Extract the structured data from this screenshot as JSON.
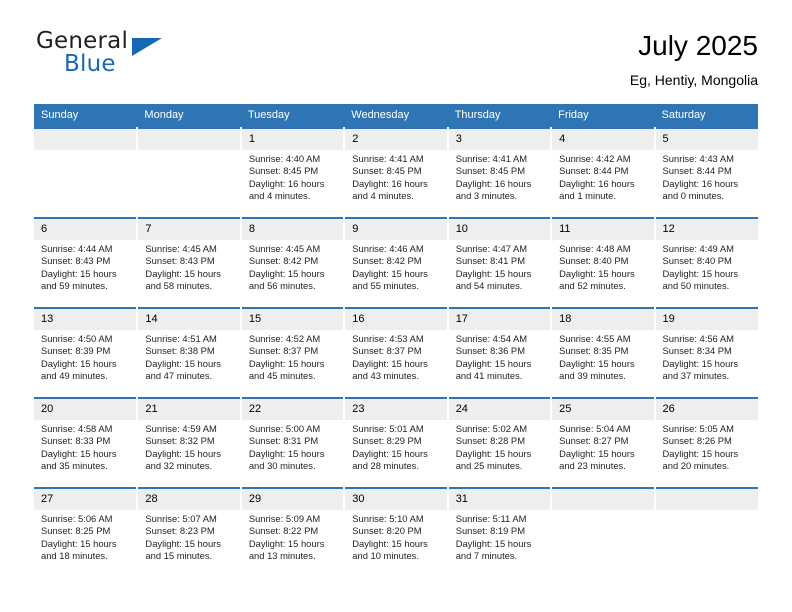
{
  "brand": {
    "name_part1": "General",
    "name_part2": "Blue",
    "logo_icon": "triangle-logo-icon"
  },
  "header": {
    "title": "July 2025",
    "subtitle": "Eg, Hentiy, Mongolia"
  },
  "colors": {
    "header_blue": "#2f75b5",
    "brand_blue": "#1668b3",
    "daynum_gray": "#eeeeee",
    "text": "#231f20"
  },
  "weekday_headers": [
    "Sunday",
    "Monday",
    "Tuesday",
    "Wednesday",
    "Thursday",
    "Friday",
    "Saturday"
  ],
  "labels": {
    "sunrise": "Sunrise:",
    "sunset": "Sunset:",
    "daylight": "Daylight:"
  },
  "weeks": [
    [
      {
        "day": "",
        "empty": true
      },
      {
        "day": "",
        "empty": true
      },
      {
        "day": "1",
        "sunrise": "Sunrise: 4:40 AM",
        "sunset": "Sunset: 8:45 PM",
        "daylight": "Daylight: 16 hours and 4 minutes."
      },
      {
        "day": "2",
        "sunrise": "Sunrise: 4:41 AM",
        "sunset": "Sunset: 8:45 PM",
        "daylight": "Daylight: 16 hours and 4 minutes."
      },
      {
        "day": "3",
        "sunrise": "Sunrise: 4:41 AM",
        "sunset": "Sunset: 8:45 PM",
        "daylight": "Daylight: 16 hours and 3 minutes."
      },
      {
        "day": "4",
        "sunrise": "Sunrise: 4:42 AM",
        "sunset": "Sunset: 8:44 PM",
        "daylight": "Daylight: 16 hours and 1 minute."
      },
      {
        "day": "5",
        "sunrise": "Sunrise: 4:43 AM",
        "sunset": "Sunset: 8:44 PM",
        "daylight": "Daylight: 16 hours and 0 minutes."
      }
    ],
    [
      {
        "day": "6",
        "sunrise": "Sunrise: 4:44 AM",
        "sunset": "Sunset: 8:43 PM",
        "daylight": "Daylight: 15 hours and 59 minutes."
      },
      {
        "day": "7",
        "sunrise": "Sunrise: 4:45 AM",
        "sunset": "Sunset: 8:43 PM",
        "daylight": "Daylight: 15 hours and 58 minutes."
      },
      {
        "day": "8",
        "sunrise": "Sunrise: 4:45 AM",
        "sunset": "Sunset: 8:42 PM",
        "daylight": "Daylight: 15 hours and 56 minutes."
      },
      {
        "day": "9",
        "sunrise": "Sunrise: 4:46 AM",
        "sunset": "Sunset: 8:42 PM",
        "daylight": "Daylight: 15 hours and 55 minutes."
      },
      {
        "day": "10",
        "sunrise": "Sunrise: 4:47 AM",
        "sunset": "Sunset: 8:41 PM",
        "daylight": "Daylight: 15 hours and 54 minutes."
      },
      {
        "day": "11",
        "sunrise": "Sunrise: 4:48 AM",
        "sunset": "Sunset: 8:40 PM",
        "daylight": "Daylight: 15 hours and 52 minutes."
      },
      {
        "day": "12",
        "sunrise": "Sunrise: 4:49 AM",
        "sunset": "Sunset: 8:40 PM",
        "daylight": "Daylight: 15 hours and 50 minutes."
      }
    ],
    [
      {
        "day": "13",
        "sunrise": "Sunrise: 4:50 AM",
        "sunset": "Sunset: 8:39 PM",
        "daylight": "Daylight: 15 hours and 49 minutes."
      },
      {
        "day": "14",
        "sunrise": "Sunrise: 4:51 AM",
        "sunset": "Sunset: 8:38 PM",
        "daylight": "Daylight: 15 hours and 47 minutes."
      },
      {
        "day": "15",
        "sunrise": "Sunrise: 4:52 AM",
        "sunset": "Sunset: 8:37 PM",
        "daylight": "Daylight: 15 hours and 45 minutes."
      },
      {
        "day": "16",
        "sunrise": "Sunrise: 4:53 AM",
        "sunset": "Sunset: 8:37 PM",
        "daylight": "Daylight: 15 hours and 43 minutes."
      },
      {
        "day": "17",
        "sunrise": "Sunrise: 4:54 AM",
        "sunset": "Sunset: 8:36 PM",
        "daylight": "Daylight: 15 hours and 41 minutes."
      },
      {
        "day": "18",
        "sunrise": "Sunrise: 4:55 AM",
        "sunset": "Sunset: 8:35 PM",
        "daylight": "Daylight: 15 hours and 39 minutes."
      },
      {
        "day": "19",
        "sunrise": "Sunrise: 4:56 AM",
        "sunset": "Sunset: 8:34 PM",
        "daylight": "Daylight: 15 hours and 37 minutes."
      }
    ],
    [
      {
        "day": "20",
        "sunrise": "Sunrise: 4:58 AM",
        "sunset": "Sunset: 8:33 PM",
        "daylight": "Daylight: 15 hours and 35 minutes."
      },
      {
        "day": "21",
        "sunrise": "Sunrise: 4:59 AM",
        "sunset": "Sunset: 8:32 PM",
        "daylight": "Daylight: 15 hours and 32 minutes."
      },
      {
        "day": "22",
        "sunrise": "Sunrise: 5:00 AM",
        "sunset": "Sunset: 8:31 PM",
        "daylight": "Daylight: 15 hours and 30 minutes."
      },
      {
        "day": "23",
        "sunrise": "Sunrise: 5:01 AM",
        "sunset": "Sunset: 8:29 PM",
        "daylight": "Daylight: 15 hours and 28 minutes."
      },
      {
        "day": "24",
        "sunrise": "Sunrise: 5:02 AM",
        "sunset": "Sunset: 8:28 PM",
        "daylight": "Daylight: 15 hours and 25 minutes."
      },
      {
        "day": "25",
        "sunrise": "Sunrise: 5:04 AM",
        "sunset": "Sunset: 8:27 PM",
        "daylight": "Daylight: 15 hours and 23 minutes."
      },
      {
        "day": "26",
        "sunrise": "Sunrise: 5:05 AM",
        "sunset": "Sunset: 8:26 PM",
        "daylight": "Daylight: 15 hours and 20 minutes."
      }
    ],
    [
      {
        "day": "27",
        "sunrise": "Sunrise: 5:06 AM",
        "sunset": "Sunset: 8:25 PM",
        "daylight": "Daylight: 15 hours and 18 minutes."
      },
      {
        "day": "28",
        "sunrise": "Sunrise: 5:07 AM",
        "sunset": "Sunset: 8:23 PM",
        "daylight": "Daylight: 15 hours and 15 minutes."
      },
      {
        "day": "29",
        "sunrise": "Sunrise: 5:09 AM",
        "sunset": "Sunset: 8:22 PM",
        "daylight": "Daylight: 15 hours and 13 minutes."
      },
      {
        "day": "30",
        "sunrise": "Sunrise: 5:10 AM",
        "sunset": "Sunset: 8:20 PM",
        "daylight": "Daylight: 15 hours and 10 minutes."
      },
      {
        "day": "31",
        "sunrise": "Sunrise: 5:11 AM",
        "sunset": "Sunset: 8:19 PM",
        "daylight": "Daylight: 15 hours and 7 minutes."
      },
      {
        "day": "",
        "empty": true
      },
      {
        "day": "",
        "empty": true
      }
    ]
  ]
}
